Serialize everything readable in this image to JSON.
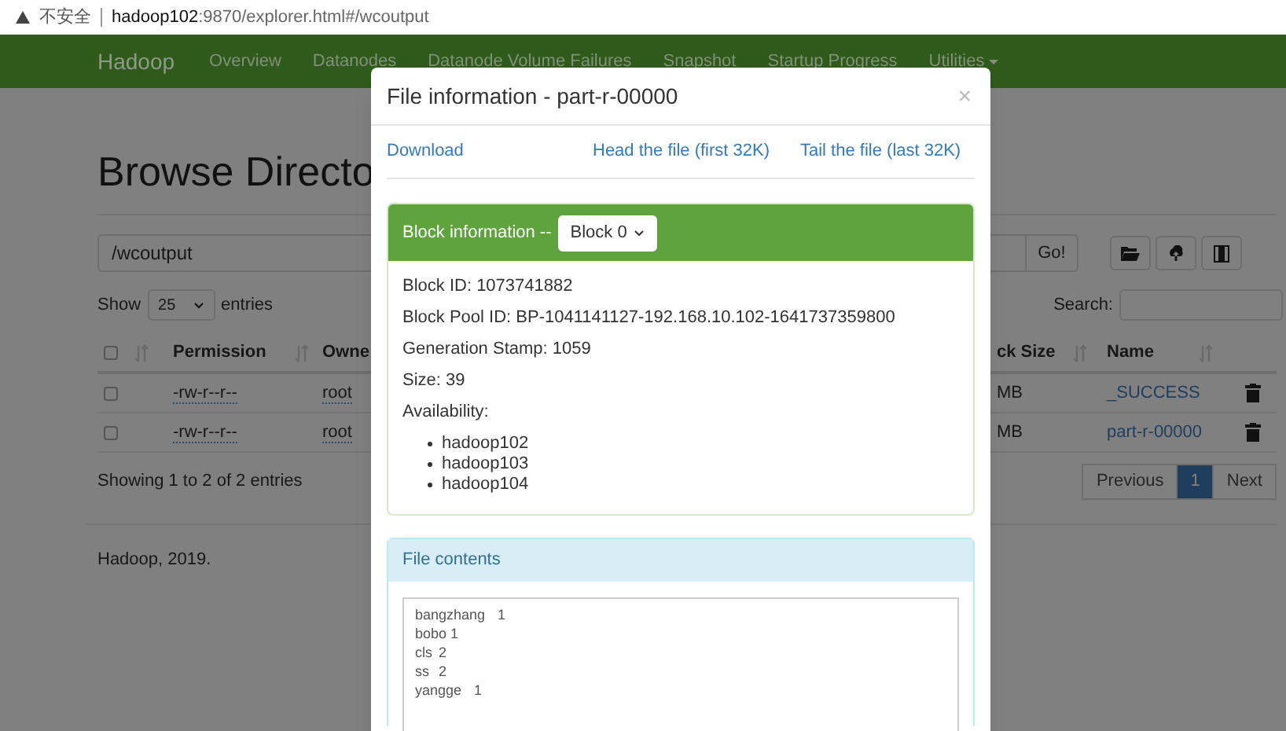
{
  "browser": {
    "security": "不安全",
    "url_host": "hadoop102",
    "url_rest": ":9870/explorer.html#/wcoutput"
  },
  "navbar": {
    "brand": "Hadoop",
    "items": [
      {
        "label": "Overview",
        "dropdown": false
      },
      {
        "label": "Datanodes",
        "dropdown": false
      },
      {
        "label": "Datanode Volume Failures",
        "dropdown": false
      },
      {
        "label": "Snapshot",
        "dropdown": false
      },
      {
        "label": "Startup Progress",
        "dropdown": false
      },
      {
        "label": "Utilities",
        "dropdown": true
      }
    ]
  },
  "page": {
    "heading": "Browse Directo",
    "path": "/wcoutput",
    "go": "Go!",
    "show": "Show",
    "page_size": "25",
    "entries": "entries",
    "search_label": "Search:",
    "select_all_checked": false,
    "columns": [
      {
        "label": "Permission"
      },
      {
        "label": "Owne"
      },
      {
        "label": "ck Size"
      },
      {
        "label": "Name"
      }
    ],
    "rows": [
      {
        "checked": false,
        "permission": "-rw-r--r--",
        "owner": "root",
        "size": "MB",
        "name": "_SUCCESS"
      },
      {
        "checked": false,
        "permission": "-rw-r--r--",
        "owner": "root",
        "size": "MB",
        "name": "part-r-00000"
      }
    ],
    "info": "Showing 1 to 2 of 2 entries",
    "pages": [
      {
        "label": "Previous",
        "selected": false
      },
      {
        "label": "1",
        "selected": true
      },
      {
        "label": "Next",
        "selected": false
      }
    ],
    "footer": "Hadoop, 2019."
  },
  "modal": {
    "title": "File information - part-r-00000",
    "close": "×",
    "links": [
      "Download",
      "Head the file (first 32K)",
      "Tail the file (last 32K)"
    ],
    "block": {
      "label": "Block information --",
      "select": "Block 0",
      "fields": [
        "Block ID: 1073741882",
        "Block Pool ID: BP-1041141127-192.168.10.102-1641737359800",
        "Generation Stamp: 1059",
        "Size: 39",
        "Availability:"
      ],
      "hosts": [
        "hadoop102",
        "hadoop103",
        "hadoop104"
      ]
    },
    "contents": {
      "title": "File contents",
      "lines": [
        "bangzhang\t1",
        "bobo\t1",
        "cls\t2",
        "ss\t2",
        "yangge\t1"
      ]
    }
  }
}
